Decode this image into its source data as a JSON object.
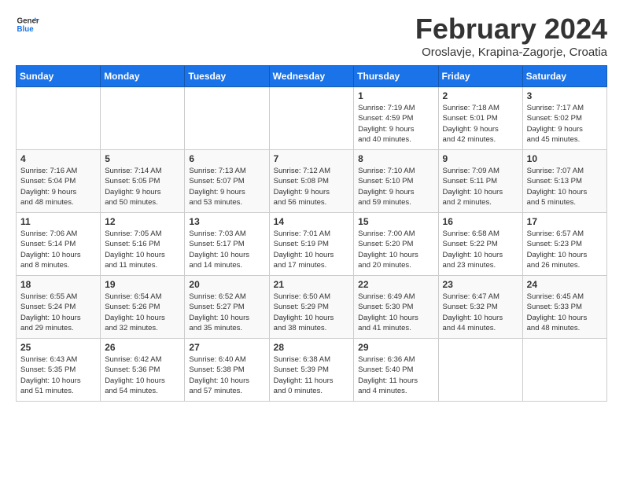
{
  "header": {
    "logo_general": "General",
    "logo_blue": "Blue",
    "month_title": "February 2024",
    "subtitle": "Oroslavje, Krapina-Zagorje, Croatia"
  },
  "calendar": {
    "days_of_week": [
      "Sunday",
      "Monday",
      "Tuesday",
      "Wednesday",
      "Thursday",
      "Friday",
      "Saturday"
    ],
    "weeks": [
      [
        {
          "day": "",
          "info": ""
        },
        {
          "day": "",
          "info": ""
        },
        {
          "day": "",
          "info": ""
        },
        {
          "day": "",
          "info": ""
        },
        {
          "day": "1",
          "info": "Sunrise: 7:19 AM\nSunset: 4:59 PM\nDaylight: 9 hours\nand 40 minutes."
        },
        {
          "day": "2",
          "info": "Sunrise: 7:18 AM\nSunset: 5:01 PM\nDaylight: 9 hours\nand 42 minutes."
        },
        {
          "day": "3",
          "info": "Sunrise: 7:17 AM\nSunset: 5:02 PM\nDaylight: 9 hours\nand 45 minutes."
        }
      ],
      [
        {
          "day": "4",
          "info": "Sunrise: 7:16 AM\nSunset: 5:04 PM\nDaylight: 9 hours\nand 48 minutes."
        },
        {
          "day": "5",
          "info": "Sunrise: 7:14 AM\nSunset: 5:05 PM\nDaylight: 9 hours\nand 50 minutes."
        },
        {
          "day": "6",
          "info": "Sunrise: 7:13 AM\nSunset: 5:07 PM\nDaylight: 9 hours\nand 53 minutes."
        },
        {
          "day": "7",
          "info": "Sunrise: 7:12 AM\nSunset: 5:08 PM\nDaylight: 9 hours\nand 56 minutes."
        },
        {
          "day": "8",
          "info": "Sunrise: 7:10 AM\nSunset: 5:10 PM\nDaylight: 9 hours\nand 59 minutes."
        },
        {
          "day": "9",
          "info": "Sunrise: 7:09 AM\nSunset: 5:11 PM\nDaylight: 10 hours\nand 2 minutes."
        },
        {
          "day": "10",
          "info": "Sunrise: 7:07 AM\nSunset: 5:13 PM\nDaylight: 10 hours\nand 5 minutes."
        }
      ],
      [
        {
          "day": "11",
          "info": "Sunrise: 7:06 AM\nSunset: 5:14 PM\nDaylight: 10 hours\nand 8 minutes."
        },
        {
          "day": "12",
          "info": "Sunrise: 7:05 AM\nSunset: 5:16 PM\nDaylight: 10 hours\nand 11 minutes."
        },
        {
          "day": "13",
          "info": "Sunrise: 7:03 AM\nSunset: 5:17 PM\nDaylight: 10 hours\nand 14 minutes."
        },
        {
          "day": "14",
          "info": "Sunrise: 7:01 AM\nSunset: 5:19 PM\nDaylight: 10 hours\nand 17 minutes."
        },
        {
          "day": "15",
          "info": "Sunrise: 7:00 AM\nSunset: 5:20 PM\nDaylight: 10 hours\nand 20 minutes."
        },
        {
          "day": "16",
          "info": "Sunrise: 6:58 AM\nSunset: 5:22 PM\nDaylight: 10 hours\nand 23 minutes."
        },
        {
          "day": "17",
          "info": "Sunrise: 6:57 AM\nSunset: 5:23 PM\nDaylight: 10 hours\nand 26 minutes."
        }
      ],
      [
        {
          "day": "18",
          "info": "Sunrise: 6:55 AM\nSunset: 5:24 PM\nDaylight: 10 hours\nand 29 minutes."
        },
        {
          "day": "19",
          "info": "Sunrise: 6:54 AM\nSunset: 5:26 PM\nDaylight: 10 hours\nand 32 minutes."
        },
        {
          "day": "20",
          "info": "Sunrise: 6:52 AM\nSunset: 5:27 PM\nDaylight: 10 hours\nand 35 minutes."
        },
        {
          "day": "21",
          "info": "Sunrise: 6:50 AM\nSunset: 5:29 PM\nDaylight: 10 hours\nand 38 minutes."
        },
        {
          "day": "22",
          "info": "Sunrise: 6:49 AM\nSunset: 5:30 PM\nDaylight: 10 hours\nand 41 minutes."
        },
        {
          "day": "23",
          "info": "Sunrise: 6:47 AM\nSunset: 5:32 PM\nDaylight: 10 hours\nand 44 minutes."
        },
        {
          "day": "24",
          "info": "Sunrise: 6:45 AM\nSunset: 5:33 PM\nDaylight: 10 hours\nand 48 minutes."
        }
      ],
      [
        {
          "day": "25",
          "info": "Sunrise: 6:43 AM\nSunset: 5:35 PM\nDaylight: 10 hours\nand 51 minutes."
        },
        {
          "day": "26",
          "info": "Sunrise: 6:42 AM\nSunset: 5:36 PM\nDaylight: 10 hours\nand 54 minutes."
        },
        {
          "day": "27",
          "info": "Sunrise: 6:40 AM\nSunset: 5:38 PM\nDaylight: 10 hours\nand 57 minutes."
        },
        {
          "day": "28",
          "info": "Sunrise: 6:38 AM\nSunset: 5:39 PM\nDaylight: 11 hours\nand 0 minutes."
        },
        {
          "day": "29",
          "info": "Sunrise: 6:36 AM\nSunset: 5:40 PM\nDaylight: 11 hours\nand 4 minutes."
        },
        {
          "day": "",
          "info": ""
        },
        {
          "day": "",
          "info": ""
        }
      ]
    ]
  }
}
